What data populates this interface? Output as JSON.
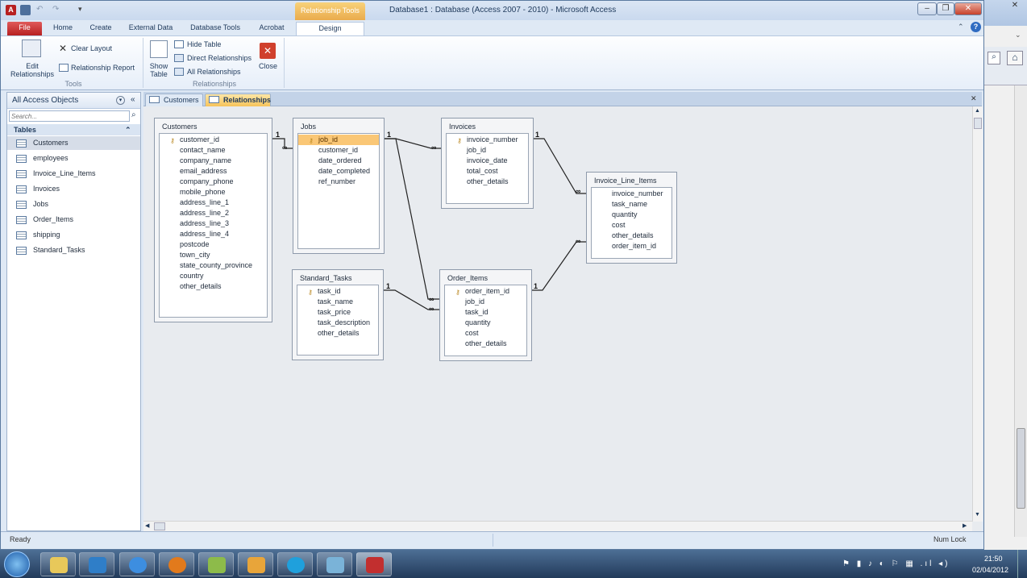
{
  "window": {
    "title": "Database1 : Database (Access 2007 - 2010)  -  Microsoft Access",
    "context_tab_group": "Relationship Tools",
    "controls": {
      "minimize": "–",
      "restore": "❐",
      "close": "✕"
    }
  },
  "ribbon_tabs": [
    "File",
    "Home",
    "Create",
    "External Data",
    "Database Tools",
    "Acrobat",
    "Design"
  ],
  "ribbon": {
    "edit_relationships": "Edit Relationships",
    "clear_layout": "Clear Layout",
    "relationship_report": "Relationship Report",
    "tools_group": "Tools",
    "show_table": "Show Table",
    "hide_table": "Hide Table",
    "direct_relationships": "Direct Relationships",
    "all_relationships": "All Relationships",
    "close": "Close",
    "relationships_group": "Relationships"
  },
  "nav": {
    "header": "All Access Objects",
    "search_placeholder": "Search...",
    "group": "Tables",
    "items": [
      "Customers",
      "employees",
      "Invoice_Line_Items",
      "Invoices",
      "Jobs",
      "Order_Items",
      "shipping",
      "Standard_Tasks"
    ]
  },
  "doc_tabs": [
    "Customers",
    "Relationships"
  ],
  "tables": {
    "customers": {
      "name": "Customers",
      "fields": [
        "customer_id",
        "contact_name",
        "company_name",
        "email_address",
        "company_phone",
        "mobile_phone",
        "address_line_1",
        "address_line_2",
        "address_line_3",
        "address_line_4",
        "postcode",
        "town_city",
        "state_county_province",
        "country",
        "other_details"
      ]
    },
    "jobs": {
      "name": "Jobs",
      "fields": [
        "job_id",
        "customer_id",
        "date_ordered",
        "date_completed",
        "ref_number"
      ]
    },
    "invoices": {
      "name": "Invoices",
      "fields": [
        "invoice_number",
        "job_id",
        "invoice_date",
        "total_cost",
        "other_details"
      ]
    },
    "invoice_line_items": {
      "name": "Invoice_Line_Items",
      "fields": [
        "invoice_number",
        "task_name",
        "quantity",
        "cost",
        "other_details",
        "order_item_id"
      ]
    },
    "standard_tasks": {
      "name": "Standard_Tasks",
      "fields": [
        "task_id",
        "task_name",
        "task_price",
        "task_description",
        "other_details"
      ]
    },
    "order_items": {
      "name": "Order_Items",
      "fields": [
        "order_item_id",
        "job_id",
        "task_id",
        "quantity",
        "cost",
        "other_details"
      ]
    }
  },
  "rel_labels": {
    "one": "1",
    "many": "∞"
  },
  "status": {
    "left": "Ready",
    "right": "Num Lock"
  },
  "taskbar": {
    "time": "21:50",
    "date": "02/04/2012"
  }
}
